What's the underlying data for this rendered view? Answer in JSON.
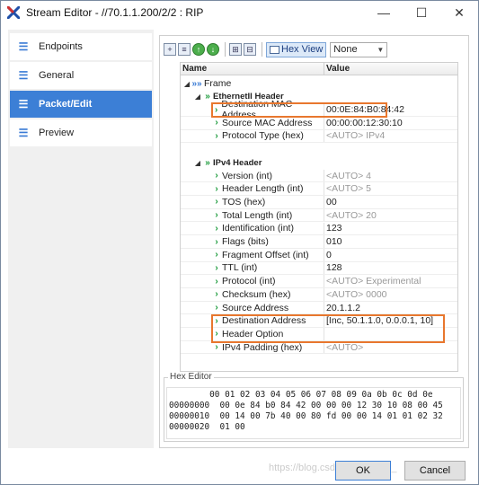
{
  "window": {
    "title": "Stream Editor - //70.1.1.200/2/2 : RIP",
    "minimize_glyph": "—",
    "maximize_glyph": "☐",
    "close_glyph": "✕"
  },
  "nav": {
    "items": [
      {
        "label": "Endpoints",
        "icon": "list-icon",
        "active": false
      },
      {
        "label": "General",
        "icon": "list-icon",
        "active": false
      },
      {
        "label": "Packet/Edit",
        "icon": "list-icon",
        "active": true
      },
      {
        "label": "Preview",
        "icon": "list-icon",
        "active": false
      }
    ]
  },
  "toolbar": {
    "hex_view_label": "Hex View",
    "view_select_value": "None"
  },
  "tree": {
    "col_name": "Name",
    "col_value": "Value",
    "frame_label": "Frame",
    "ethernet_header": "EthernetII Header",
    "ipv4_header": "IPv4 Header",
    "ethernet_fields": [
      {
        "name": "Destination MAC Address",
        "value": "00:0E:84:B0:84:42",
        "auto": false
      },
      {
        "name": "Source MAC Address",
        "value": "00:00:00:12:30:10",
        "auto": false
      },
      {
        "name": "Protocol Type (hex)",
        "value": "<AUTO> IPv4",
        "auto": true
      }
    ],
    "ipv4_fields": [
      {
        "name": "Version (int)",
        "value": "<AUTO> 4",
        "auto": true
      },
      {
        "name": "Header Length (int)",
        "value": "<AUTO> 5",
        "auto": true
      },
      {
        "name": "TOS (hex)",
        "value": "00",
        "auto": false
      },
      {
        "name": "Total Length (int)",
        "value": "<AUTO> 20",
        "auto": true
      },
      {
        "name": "Identification  (int)",
        "value": "123",
        "auto": false
      },
      {
        "name": "Flags (bits)",
        "value": "010",
        "auto": false
      },
      {
        "name": "Fragment Offset (int)",
        "value": "0",
        "auto": false
      },
      {
        "name": "TTL (int)",
        "value": "128",
        "auto": false
      },
      {
        "name": "Protocol (int)",
        "value": "<AUTO> Experimental",
        "auto": true
      },
      {
        "name": "Checksum (hex)",
        "value": "<AUTO> 0000",
        "auto": true
      },
      {
        "name": "Source Address",
        "value": "20.1.1.2",
        "auto": false
      },
      {
        "name": "Destination Address",
        "value": "[Inc, 50.1.1.0, 0.0.0.1, 10]",
        "auto": false
      },
      {
        "name": "Header Option",
        "value": "",
        "auto": false
      },
      {
        "name": "IPv4 Padding (hex)",
        "value": "<AUTO>",
        "auto": true
      }
    ]
  },
  "hex_editor": {
    "label": "Hex Editor",
    "header": "        00 01 02 03 04 05 06 07 08 09 0a 0b 0c 0d 0e",
    "lines": [
      "00000000  00 0e 84 b0 84 42 00 00 00 12 30 10 08 00 45",
      "00000010  00 14 00 7b 40 00 80 fd 00 00 14 01 01 02 32",
      "00000020  01 00"
    ]
  },
  "buttons": {
    "ok": "OK",
    "cancel": "Cancel"
  },
  "watermark": "https://blog.csdn.net/xiaobin_"
}
